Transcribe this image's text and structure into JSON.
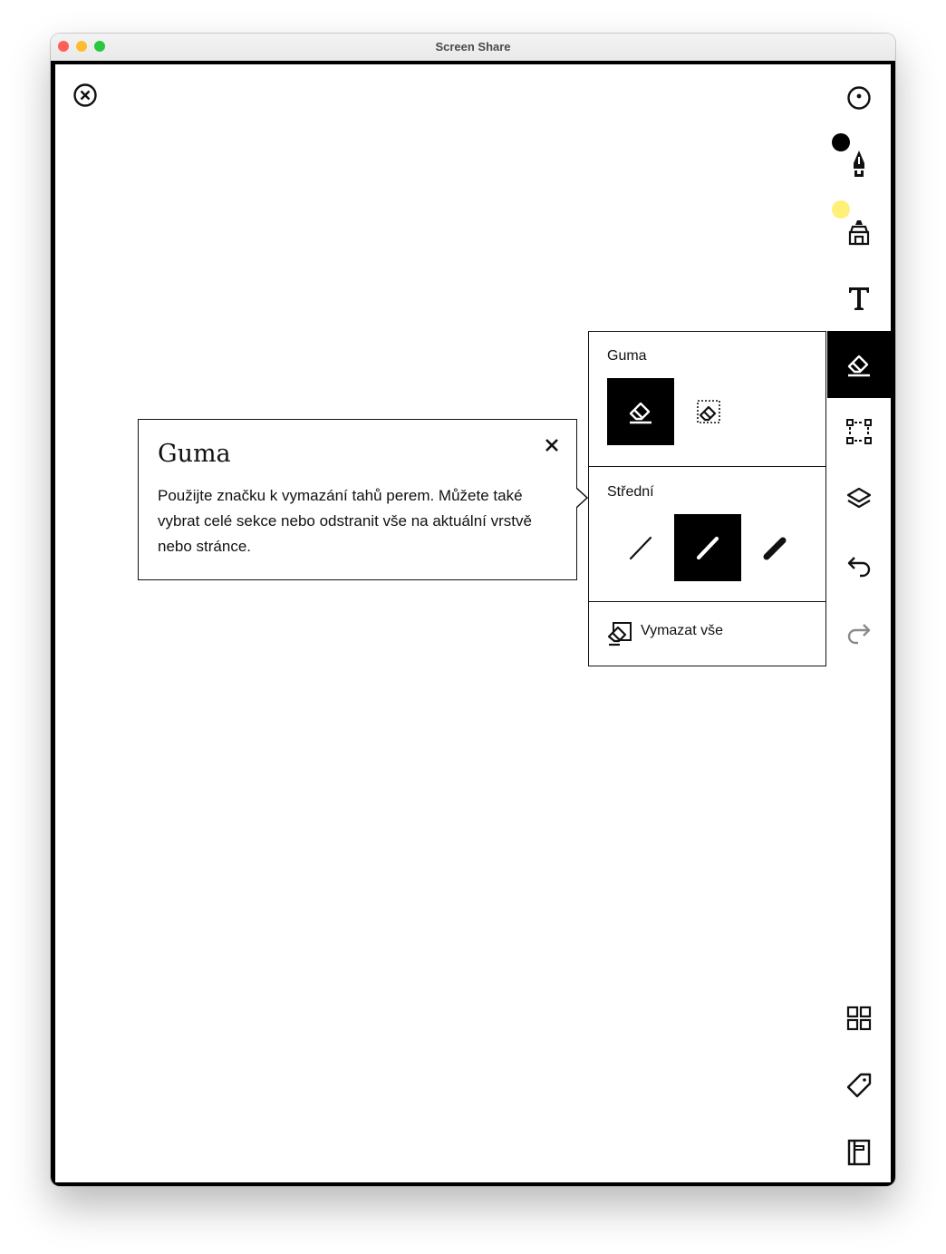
{
  "window": {
    "title": "Screen Share",
    "traffic_lights": {
      "close": "#ff5f57",
      "minimize": "#febc2e",
      "zoom": "#28c840"
    }
  },
  "toolbar": {
    "items": [
      {
        "name": "pointer-tool",
        "icon": "circle-dot-icon"
      },
      {
        "name": "pen-tool",
        "icon": "pen-nib-icon",
        "color": "#000000"
      },
      {
        "name": "highlighter-tool",
        "icon": "highlighter-icon",
        "color": "#fff07a"
      },
      {
        "name": "text-tool",
        "icon": "text-T-icon",
        "label": "T"
      },
      {
        "name": "eraser-tool",
        "icon": "eraser-icon",
        "active": true
      },
      {
        "name": "select-tool",
        "icon": "selection-icon"
      },
      {
        "name": "layers-tool",
        "icon": "layers-icon"
      },
      {
        "name": "undo",
        "icon": "undo-arrow-icon"
      },
      {
        "name": "redo",
        "icon": "redo-arrow-icon",
        "disabled": true
      },
      {
        "name": "pages-grid",
        "icon": "grid-icon"
      },
      {
        "name": "tag",
        "icon": "tag-icon"
      },
      {
        "name": "notebook",
        "icon": "notebook-icon"
      }
    ]
  },
  "eraser_panel": {
    "title": "Guma",
    "modes": [
      {
        "name": "stroke-eraser",
        "icon": "eraser-icon",
        "selected": true
      },
      {
        "name": "area-eraser",
        "icon": "eraser-selection-icon",
        "selected": false
      }
    ],
    "size_label": "Střední",
    "sizes": [
      {
        "name": "thin",
        "selected": false
      },
      {
        "name": "medium",
        "selected": true
      },
      {
        "name": "thick",
        "selected": false
      }
    ],
    "clear_all_label": "Vymazat vše"
  },
  "help_popup": {
    "title": "Guma",
    "body": "Použijte značku k vymazání tahů perem. Můžete také vybrat celé sekce nebo odstranit vše na aktuální vrstvě nebo stránce."
  }
}
